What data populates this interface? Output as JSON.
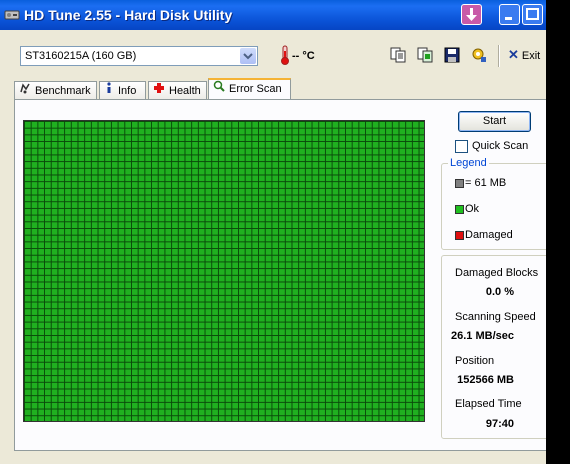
{
  "window": {
    "title": "HD Tune 2.55 - Hard Disk Utility",
    "accent": "#0a52d6"
  },
  "toolbar": {
    "drive_value": "ST3160215A (160 GB)",
    "temperature": "-- °C",
    "exit_label": "Exit",
    "icons": [
      "copy-icon",
      "copy-all-icon",
      "save-icon",
      "options-icon"
    ]
  },
  "tabs": [
    {
      "label": "Benchmark",
      "icon": "benchmark-icon"
    },
    {
      "label": "Info",
      "icon": "info-icon"
    },
    {
      "label": "Health",
      "icon": "health-icon"
    },
    {
      "label": "Error Scan",
      "icon": "magnifier-icon",
      "active": true
    }
  ],
  "scan": {
    "start_label": "Start",
    "quick_scan_label": "Quick Scan",
    "quick_scan_checked": false,
    "progress_fraction": 1.0,
    "block_color": "#20b020"
  },
  "legend": {
    "title": "Legend",
    "items": [
      {
        "label": "= 61 MB",
        "color": "#808080"
      },
      {
        "label": "Ok",
        "color": "#20c020"
      },
      {
        "label": "Damaged",
        "color": "#e01010"
      }
    ]
  },
  "stats": {
    "damaged_blocks_label": "Damaged Blocks",
    "damaged_blocks_value": "0.0 %",
    "scanning_speed_label": "Scanning Speed",
    "scanning_speed_value": "26.1 MB/sec",
    "position_label": "Position",
    "position_value": "152566 MB",
    "elapsed_label": "Elapsed Time",
    "elapsed_value": "97:40"
  }
}
